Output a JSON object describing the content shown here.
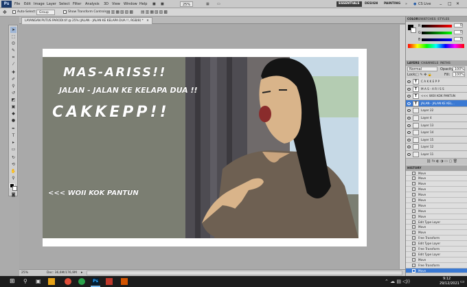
{
  "app": {
    "logo": "Ps",
    "menu": [
      "File",
      "Edit",
      "Image",
      "Layer",
      "Select",
      "Filter",
      "Analysis",
      "3D",
      "View",
      "Window",
      "Help"
    ],
    "zoom": "25%",
    "workspaces": [
      "ESSENTIALS",
      "DESIGN",
      "PAINTING"
    ],
    "cs_live": "CS Live"
  },
  "options": {
    "auto_select_label": "Auto-Select:",
    "auto_select_value": "Group",
    "show_transform_label": "Show Transform Controls"
  },
  "document": {
    "tab_title": "LAYANGAN PUTUS PARODI.tif @ 25% (JALAN - JALAN KE KELAPA DUA !!, RGB/8) *",
    "zoom": "25%",
    "doc_size": "Doc: 36,6M/176,9M"
  },
  "canvas": {
    "line1": "MAS-ARISS!!",
    "line2": "JALAN - JALAN KE KELAPA DUA !!",
    "line3": "CAKKEPP!!",
    "line4": "<<< WOII KOK PANTUN"
  },
  "color_panel": {
    "tabs": [
      "COLOR",
      "SWATCHES",
      "STYLES"
    ],
    "sliders": [
      {
        "label": "R",
        "value": "0"
      },
      {
        "label": "G",
        "value": "0"
      },
      {
        "label": "B",
        "value": "0"
      }
    ]
  },
  "layers_panel": {
    "tabs": [
      "LAYERS",
      "CHANNELS",
      "PATHS"
    ],
    "blend_mode": "Normal",
    "opacity_label": "Opacity:",
    "opacity": "100%",
    "lock_label": "Lock:",
    "fill_label": "Fill:",
    "fill": "100%",
    "layers": [
      {
        "name": "C A K K E P P",
        "type": "T"
      },
      {
        "name": "M A S - A R I S S",
        "type": "T"
      },
      {
        "name": "<<< WOII KOK PANTUN",
        "type": "T"
      },
      {
        "name": "JALAN - JALAN KE KEL...",
        "type": "T",
        "selected": true
      },
      {
        "name": "Layer 22",
        "type": "img"
      },
      {
        "name": "Layer 4",
        "type": "img"
      },
      {
        "name": "Layer 13",
        "type": "img"
      },
      {
        "name": "Layer 14",
        "type": "img"
      },
      {
        "name": "Layer 15",
        "type": "img"
      },
      {
        "name": "Layer 12",
        "type": "img"
      },
      {
        "name": "Layer 11",
        "type": "img"
      }
    ]
  },
  "history_panel": {
    "title": "HISTORY",
    "items": [
      "Move",
      "Move",
      "Move",
      "Move",
      "Move",
      "Move",
      "Move",
      "Move",
      "Move",
      "Edit Type Layer",
      "Move",
      "Move",
      "Free Transform",
      "Edit Type Layer",
      "Free Transform",
      "Edit Type Layer",
      "Move",
      "Free Transform",
      "Move"
    ],
    "selected_index": 18
  },
  "taskbar": {
    "time": "9:12",
    "date": "29/12/2021"
  },
  "colors": {
    "accent": "#3a79d3",
    "canvas_bg": "#7b7e72"
  }
}
